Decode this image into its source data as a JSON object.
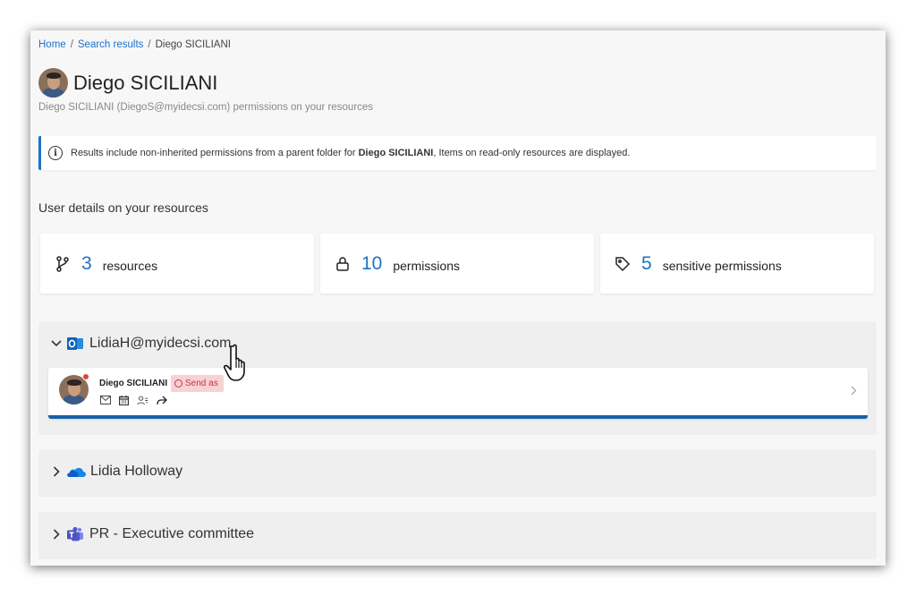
{
  "breadcrumb": {
    "items": [
      "Home",
      "Search results"
    ],
    "current": "Diego SICILIANI",
    "separator": "/"
  },
  "user": {
    "name": "Diego SICILIANI",
    "subtitle": "Diego SICILIANI (DiegoS@myidecsi.com) permissions on your resources"
  },
  "info": {
    "prefix": "Results include non-inherited permissions from a parent folder for ",
    "bold": "Diego SICILIANI",
    "suffix": ", Items on read-only resources are displayed."
  },
  "section_title": "User details on your resources",
  "stats": [
    {
      "icon": "git-branch-icon",
      "value": "3",
      "label": "resources"
    },
    {
      "icon": "lock-icon",
      "value": "10",
      "label": "permissions"
    },
    {
      "icon": "tag-icon",
      "value": "5",
      "label": "sensitive permissions"
    }
  ],
  "resources": [
    {
      "name": "LidiaH@myidecsi.com",
      "icon": "outlook-icon",
      "expanded": true,
      "permissions": [
        {
          "user": "Diego SICILIANI",
          "badge": "Send as",
          "icons": [
            "mail-icon",
            "calendar-icon",
            "contacts-icon",
            "forward-icon"
          ]
        }
      ]
    },
    {
      "name": "Lidia Holloway",
      "icon": "onedrive-icon",
      "expanded": false
    },
    {
      "name": "PR - Executive committee",
      "icon": "teams-icon",
      "expanded": false
    }
  ],
  "colors": {
    "accent": "#1a73c9",
    "badge_bg": "#f6d2d4",
    "badge_text": "#c9343f",
    "card_border": "#1660a8"
  }
}
